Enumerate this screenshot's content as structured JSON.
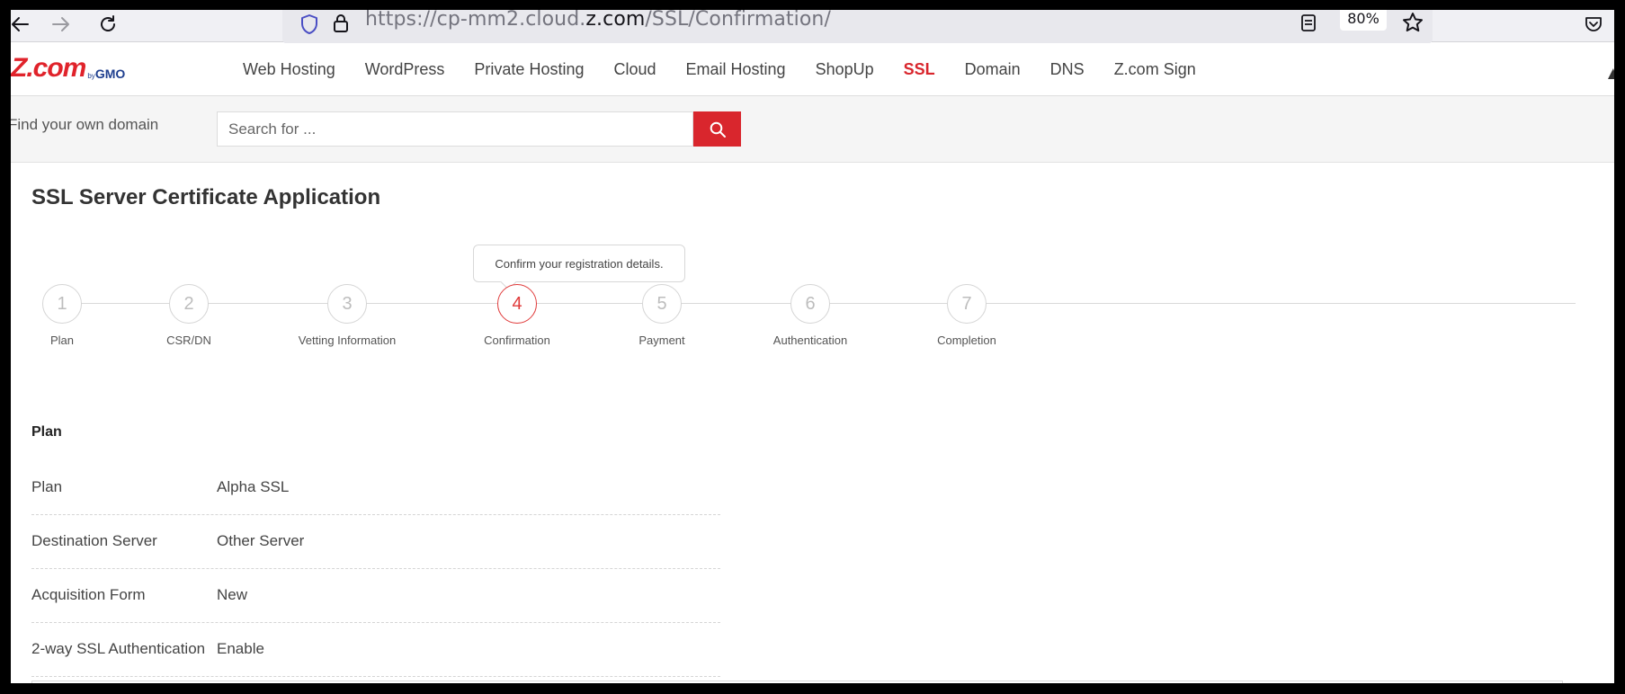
{
  "browser": {
    "url_prefix": "https://cp-mm2.cloud.",
    "url_host": "z.com",
    "url_path": "/SSL/Confirmation/",
    "zoom": "80%"
  },
  "site": {
    "logo_main": "Z.com",
    "logo_by": "by",
    "logo_gmo": "GMO",
    "nav": [
      {
        "label": "Web Hosting",
        "active": false
      },
      {
        "label": "WordPress",
        "active": false
      },
      {
        "label": "Private Hosting",
        "active": false
      },
      {
        "label": "Cloud",
        "active": false
      },
      {
        "label": "Email Hosting",
        "active": false
      },
      {
        "label": "ShopUp",
        "active": false
      },
      {
        "label": "SSL",
        "active": true
      },
      {
        "label": "Domain",
        "active": false
      },
      {
        "label": "DNS",
        "active": false
      },
      {
        "label": "Z.com Sign",
        "active": false
      }
    ]
  },
  "search": {
    "label": "Find your own domain",
    "placeholder": "Search for ..."
  },
  "page": {
    "title": "SSL Server Certificate Application",
    "tooltip": "Confirm your registration details."
  },
  "steps": [
    {
      "number": "1",
      "label": "Plan"
    },
    {
      "number": "2",
      "label": "CSR/DN"
    },
    {
      "number": "3",
      "label": "Vetting Information"
    },
    {
      "number": "4",
      "label": "Confirmation"
    },
    {
      "number": "5",
      "label": "Payment"
    },
    {
      "number": "6",
      "label": "Authentication"
    },
    {
      "number": "7",
      "label": "Completion"
    }
  ],
  "current_step": 4,
  "plan_section": {
    "title": "Plan",
    "rows": [
      {
        "label": "Plan",
        "value": "Alpha SSL"
      },
      {
        "label": "Destination Server",
        "value": "Other Server"
      },
      {
        "label": "Acquisition Form",
        "value": "New"
      },
      {
        "label": "2-way SSL Authentication",
        "value": "Enable"
      }
    ]
  },
  "colors": {
    "brand_red": "#d9262d",
    "brand_blue": "#1f3f8f"
  }
}
